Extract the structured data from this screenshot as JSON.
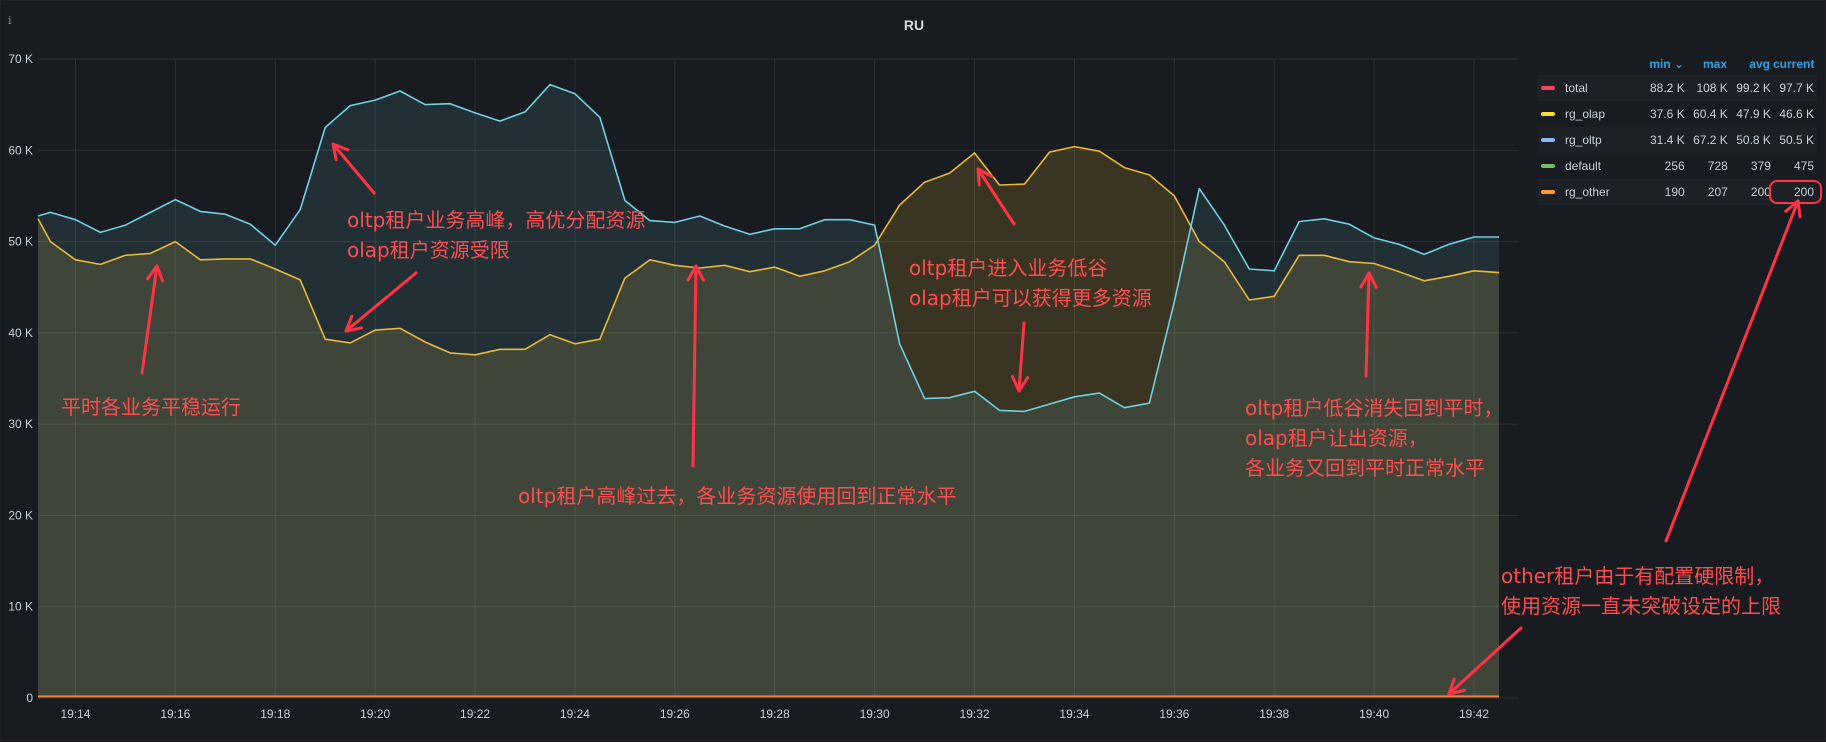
{
  "panel": {
    "title": "RU",
    "info_icon": "info-icon"
  },
  "legend": {
    "headers": [
      "min",
      "max",
      "avg",
      "current"
    ],
    "sort_indicator": "⌄",
    "rows": [
      {
        "name": "total",
        "color": "#f2495c",
        "min": "88.2 K",
        "max": "108 K",
        "avg": "99.2 K",
        "current": "97.7 K"
      },
      {
        "name": "rg_olap",
        "color": "#fade2a",
        "min": "37.6 K",
        "max": "60.4 K",
        "avg": "47.9 K",
        "current": "46.6 K"
      },
      {
        "name": "rg_oltp",
        "color": "#8ab8ff",
        "min": "31.4 K",
        "max": "67.2 K",
        "avg": "50.8 K",
        "current": "50.5 K"
      },
      {
        "name": "default",
        "color": "#73bf69",
        "min": "256",
        "max": "728",
        "avg": "379",
        "current": "475"
      },
      {
        "name": "rg_other",
        "color": "#ff9830",
        "min": "190",
        "max": "207",
        "avg": "200",
        "current": "200"
      }
    ]
  },
  "annotations": [
    {
      "id": "steady",
      "lines": [
        "平时各业务平稳运行"
      ]
    },
    {
      "id": "oltp-peak",
      "lines": [
        "oltp租户业务高峰，高优分配资源",
        "olap租户资源受限"
      ]
    },
    {
      "id": "peak-over",
      "lines": [
        "oltp租户高峰过去，各业务资源使用回到正常水平"
      ]
    },
    {
      "id": "oltp-trough",
      "lines": [
        "oltp租户进入业务低谷",
        "olap租户可以获得更多资源"
      ]
    },
    {
      "id": "trough-over",
      "lines": [
        "oltp租户低谷消失回到平时，",
        "olap租户让出资源，",
        "各业务又回到平时正常水平"
      ]
    },
    {
      "id": "other-limit",
      "lines": [
        "other租户由于有配置硬限制，",
        "使用资源一直未突破设定的上限"
      ]
    }
  ],
  "chart_data": {
    "type": "area",
    "title": "RU",
    "xlabel": "",
    "ylabel": "",
    "x": [
      "19:13:15",
      "19:13:30",
      "19:14:00",
      "19:14:30",
      "19:15:00",
      "19:15:30",
      "19:16:00",
      "19:16:30",
      "19:17:00",
      "19:17:30",
      "19:18:00",
      "19:18:30",
      "19:19:00",
      "19:19:30",
      "19:20:00",
      "19:20:30",
      "19:21:00",
      "19:21:30",
      "19:22:00",
      "19:22:30",
      "19:23:00",
      "19:23:30",
      "19:24:00",
      "19:24:30",
      "19:25:00",
      "19:25:30",
      "19:26:00",
      "19:26:30",
      "19:27:00",
      "19:27:30",
      "19:28:00",
      "19:28:30",
      "19:29:00",
      "19:29:30",
      "19:30:00",
      "19:30:30",
      "19:31:00",
      "19:31:30",
      "19:32:00",
      "19:32:30",
      "19:33:00",
      "19:33:30",
      "19:34:00",
      "19:34:30",
      "19:35:00",
      "19:35:30",
      "19:36:00",
      "19:36:30",
      "19:37:00",
      "19:37:30",
      "19:38:00",
      "19:38:30",
      "19:39:00",
      "19:39:30",
      "19:40:00",
      "19:40:30",
      "19:41:00",
      "19:41:30",
      "19:42:00",
      "19:42:30"
    ],
    "x_ticks": [
      "19:14",
      "19:16",
      "19:18",
      "19:20",
      "19:22",
      "19:24",
      "19:26",
      "19:28",
      "19:30",
      "19:32",
      "19:34",
      "19:36",
      "19:38",
      "19:40",
      "19:42"
    ],
    "y_ticks": [
      "0",
      "10 K",
      "20 K",
      "30 K",
      "40 K",
      "50 K",
      "60 K",
      "70 K"
    ],
    "ylim": [
      0,
      70000
    ],
    "grid": true,
    "legend_position": "right",
    "series": [
      {
        "name": "rg_olap",
        "color": "#eab839",
        "values": [
          52500,
          50000,
          48000,
          47500,
          48500,
          48700,
          50000,
          48000,
          48100,
          48100,
          47000,
          45800,
          39300,
          38900,
          40300,
          40500,
          39000,
          37800,
          37600,
          38200,
          38200,
          39800,
          38800,
          39300,
          46000,
          48000,
          47400,
          47100,
          47400,
          46700,
          47200,
          46200,
          46800,
          47800,
          49600,
          54000,
          56500,
          57500,
          59700,
          56200,
          56300,
          59800,
          60400,
          59900,
          58100,
          57300,
          55000,
          50000,
          47800,
          43600,
          44000,
          48500,
          48500,
          47800,
          47600,
          46700,
          45700,
          46200,
          46800,
          46600
        ]
      },
      {
        "name": "rg_oltp",
        "color": "#6ed0e0",
        "values": [
          52800,
          53200,
          52400,
          51000,
          51800,
          53200,
          54600,
          53300,
          53000,
          51900,
          49600,
          53500,
          62500,
          64900,
          65500,
          66500,
          65000,
          65100,
          64100,
          63200,
          64200,
          67200,
          66200,
          63600,
          54500,
          52300,
          52100,
          52800,
          51700,
          50800,
          51400,
          51400,
          52400,
          52400,
          51800,
          38800,
          32800,
          32900,
          33600,
          31500,
          31400,
          32200,
          33000,
          33400,
          31800,
          32300,
          43400,
          55800,
          51800,
          47000,
          46800,
          52200,
          52500,
          51900,
          50400,
          49700,
          48600,
          49700,
          50500,
          50500
        ]
      },
      {
        "name": "rg_other",
        "color": "#ef843c",
        "values": [
          200,
          200,
          200,
          200,
          200,
          200,
          200,
          200,
          200,
          200,
          200,
          200,
          200,
          200,
          200,
          200,
          200,
          200,
          200,
          200,
          200,
          200,
          200,
          200,
          200,
          200,
          200,
          200,
          200,
          200,
          200,
          200,
          200,
          200,
          200,
          200,
          200,
          200,
          200,
          200,
          200,
          200,
          200,
          200,
          200,
          200,
          200,
          200,
          200,
          200,
          200,
          200,
          200,
          200,
          200,
          200,
          200,
          200,
          200,
          200
        ]
      }
    ]
  }
}
